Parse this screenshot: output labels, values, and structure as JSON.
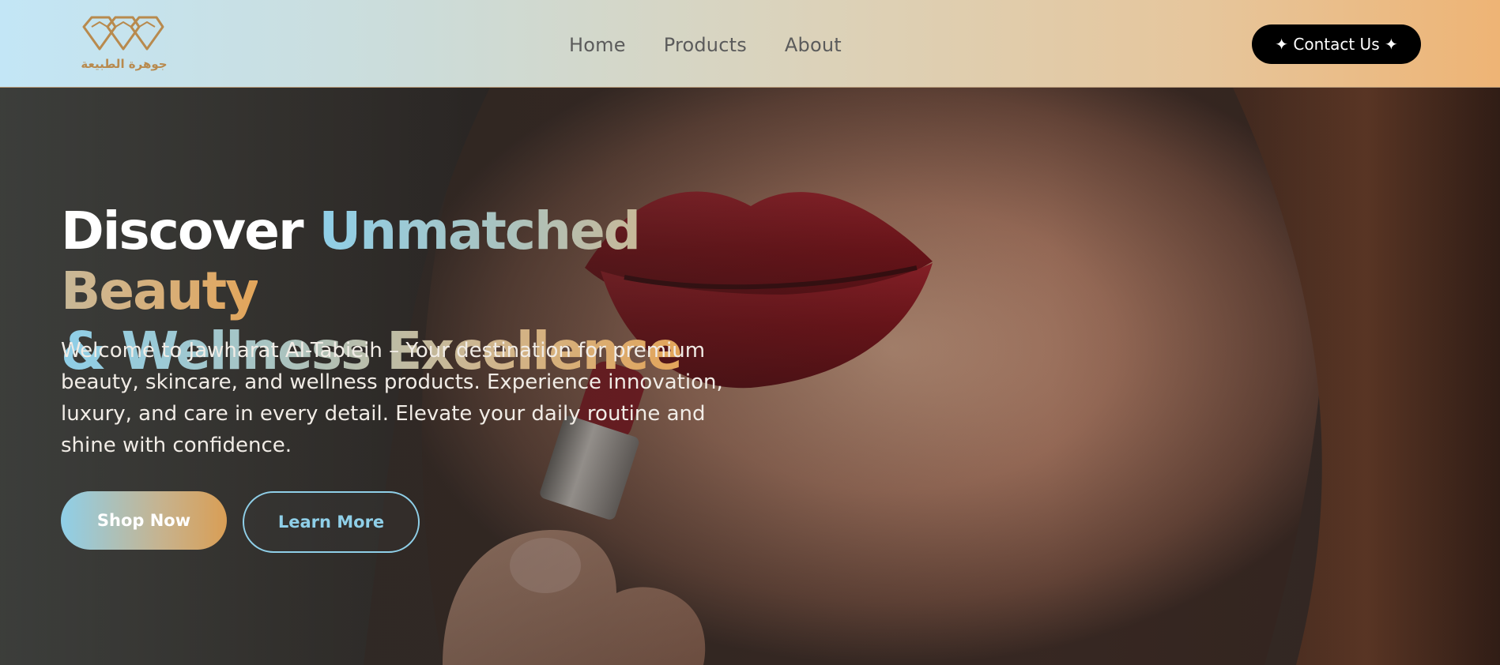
{
  "brand": {
    "logo_text": "جوهرة الطبيعة",
    "logo_color": "#b88a4e"
  },
  "nav": {
    "items": [
      {
        "label": "Home"
      },
      {
        "label": "Products"
      },
      {
        "label": "About"
      }
    ],
    "contact_label": "✦ Contact Us ✦"
  },
  "hero": {
    "headline_line1_white": "Discover ",
    "headline_line1_gradient": "Unmatched Beauty",
    "headline_line2_gradient": "& Wellness Excellence",
    "description": "Welcome to Jawharat Al-Tabieih – Your destination for premium beauty, skincare, and wellness products. Experience innovation, luxury, and care in every detail. Elevate your daily routine and shine with confidence.",
    "primary_cta": "Shop Now",
    "secondary_cta": "Learn More",
    "image": "woman-applying-red-lipstick"
  },
  "colors": {
    "accent_blue": "#8fcfe8",
    "accent_gold": "#e3a55a",
    "header_gradient_start": "#c3e6f6",
    "header_gradient_end": "#eeb475",
    "contact_bg": "#000000"
  }
}
